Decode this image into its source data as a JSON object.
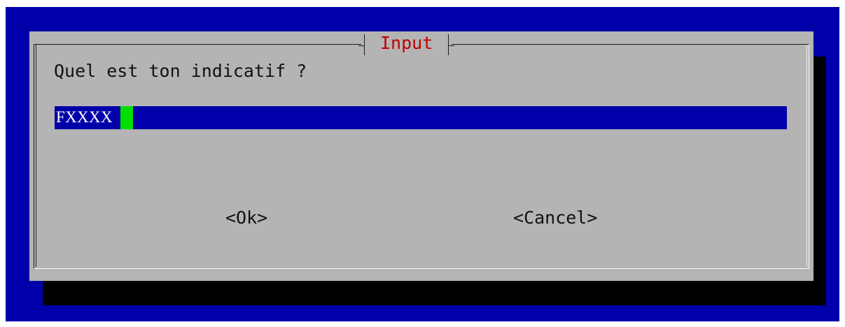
{
  "dialog": {
    "title": "Input",
    "prompt": "Quel est ton indicatif ?",
    "input": {
      "value": "FXXXX"
    },
    "buttons": {
      "ok": "<Ok>",
      "cancel": "<Cancel>"
    }
  },
  "colors": {
    "screen_background": "#0000aa",
    "dialog_background": "#b4b4b4",
    "shadow": "#000000",
    "title": "#c00000",
    "input_background": "#0000aa",
    "input_text": "#ffffff",
    "cursor": "#00e000"
  }
}
